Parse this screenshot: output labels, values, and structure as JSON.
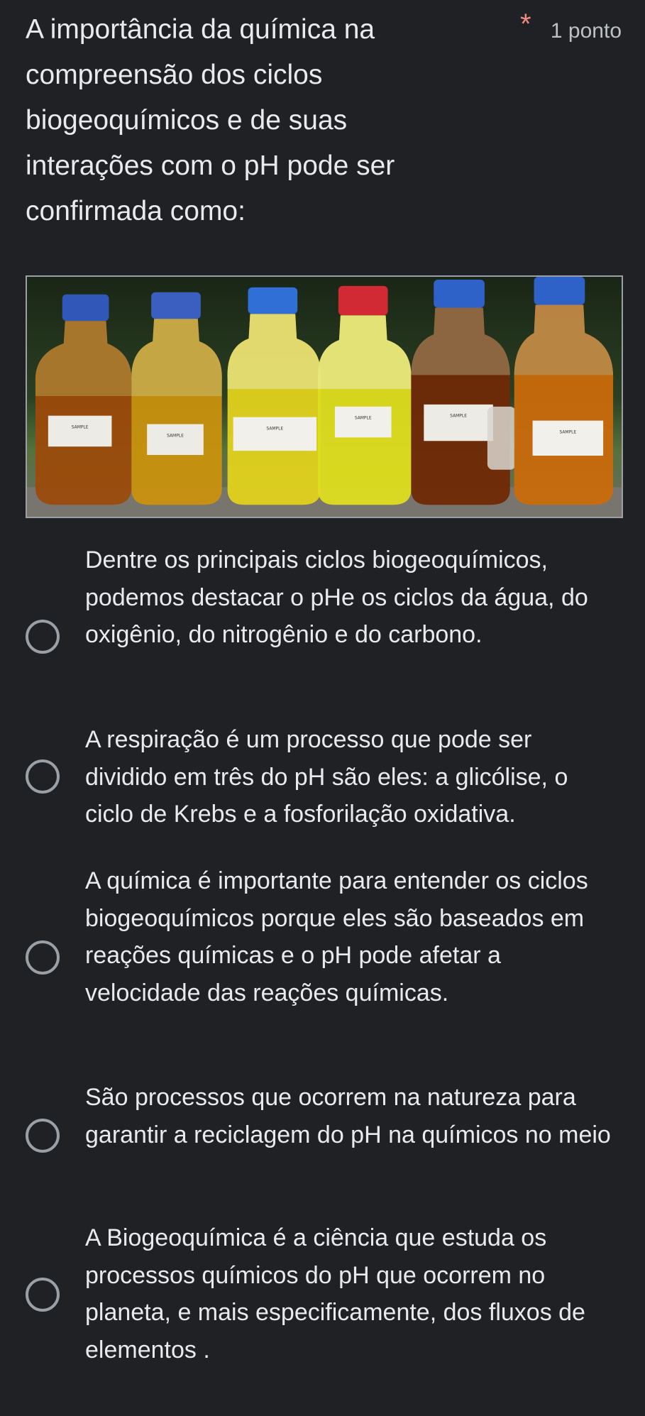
{
  "question": {
    "title": "A  importância da química na compreensão dos ciclos biogeoquímicos e de suas interações com o pH pode ser confirmada como:",
    "required_marker": "*",
    "points": "1 ponto"
  },
  "image": {
    "description_icon": "photo-bottles-icon",
    "bottle_labels": [
      "SAMPLE",
      "SAMPLE",
      "SAMPLE",
      "SAMPLE",
      "SAMPLE",
      "SAMPLE"
    ]
  },
  "options": [
    {
      "label": "Dentre os principais ciclos biogeoquímicos, podemos destacar o pHe os ciclos da água, do oxigênio, do nitrogênio e do carbono."
    },
    {
      "label": "A respiração é um processo que pode ser dividido em três do pH são eles: a glicólise, o ciclo de Krebs e a fosforilação oxidativa."
    },
    {
      "label": "A química é importante para entender os ciclos biogeoquímicos porque eles são baseados em reações químicas e o pH pode afetar a velocidade das reações químicas."
    },
    {
      "label": "São processos que ocorrem na natureza para garantir a reciclagem do pH na químicos no meio"
    },
    {
      "label": "A Biogeoquímica é a ciência que estuda os processos químicos do pH que ocorrem no planeta, e mais especificamente, dos fluxos de elementos ."
    }
  ],
  "colors": {
    "background": "#202124",
    "text": "#e8eaed",
    "required": "#f28b82",
    "radio_border": "#9aa0a6"
  }
}
